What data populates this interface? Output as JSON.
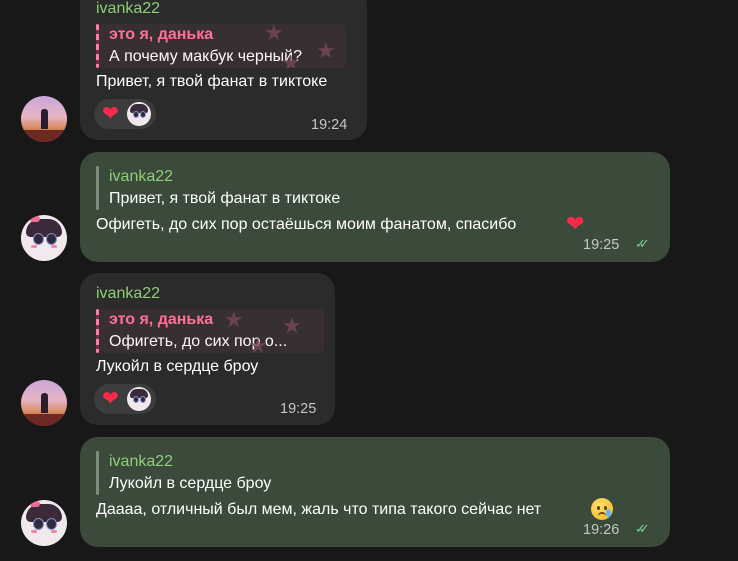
{
  "messages": [
    {
      "sender": "ivanka22",
      "reply_name": "это я, данька",
      "reply_text": "А почему макбук черный?",
      "text": "Привет, я твой фанат в тиктоке",
      "time": "19:24",
      "reactions": [
        "heart",
        "avatar"
      ]
    },
    {
      "reply_name": "ivanka22",
      "reply_text": "Привет, я твой фанат в тиктоке",
      "text": "Офигеть, до сих пор остаёшься моим фанатом, спасибо",
      "emoji": "heart",
      "time": "19:25",
      "status": "read"
    },
    {
      "sender": "ivanka22",
      "reply_name": "это я, данька",
      "reply_text": "Офигеть, до сих пор о...",
      "text": "Лукойл в сердце броу",
      "time": "19:25",
      "reactions": [
        "heart",
        "avatar"
      ]
    },
    {
      "reply_name": "ivanka22",
      "reply_text": "Лукойл в сердце броу",
      "text": "Даааа, отличный был мем, жаль что типа такого сейчас нет",
      "emoji": "crying-face",
      "time": "19:26",
      "status": "read"
    }
  ],
  "icons": {
    "heart": "❤",
    "check": "✓✓",
    "star": "★"
  },
  "colors": {
    "background": "#181818",
    "incoming_bubble": "#2b2b2b",
    "outgoing_bubble": "#3b4a3b",
    "sender_name": "#8fce79",
    "reply_pink": "#ff6f98",
    "read_check": "#7fcf8f"
  }
}
